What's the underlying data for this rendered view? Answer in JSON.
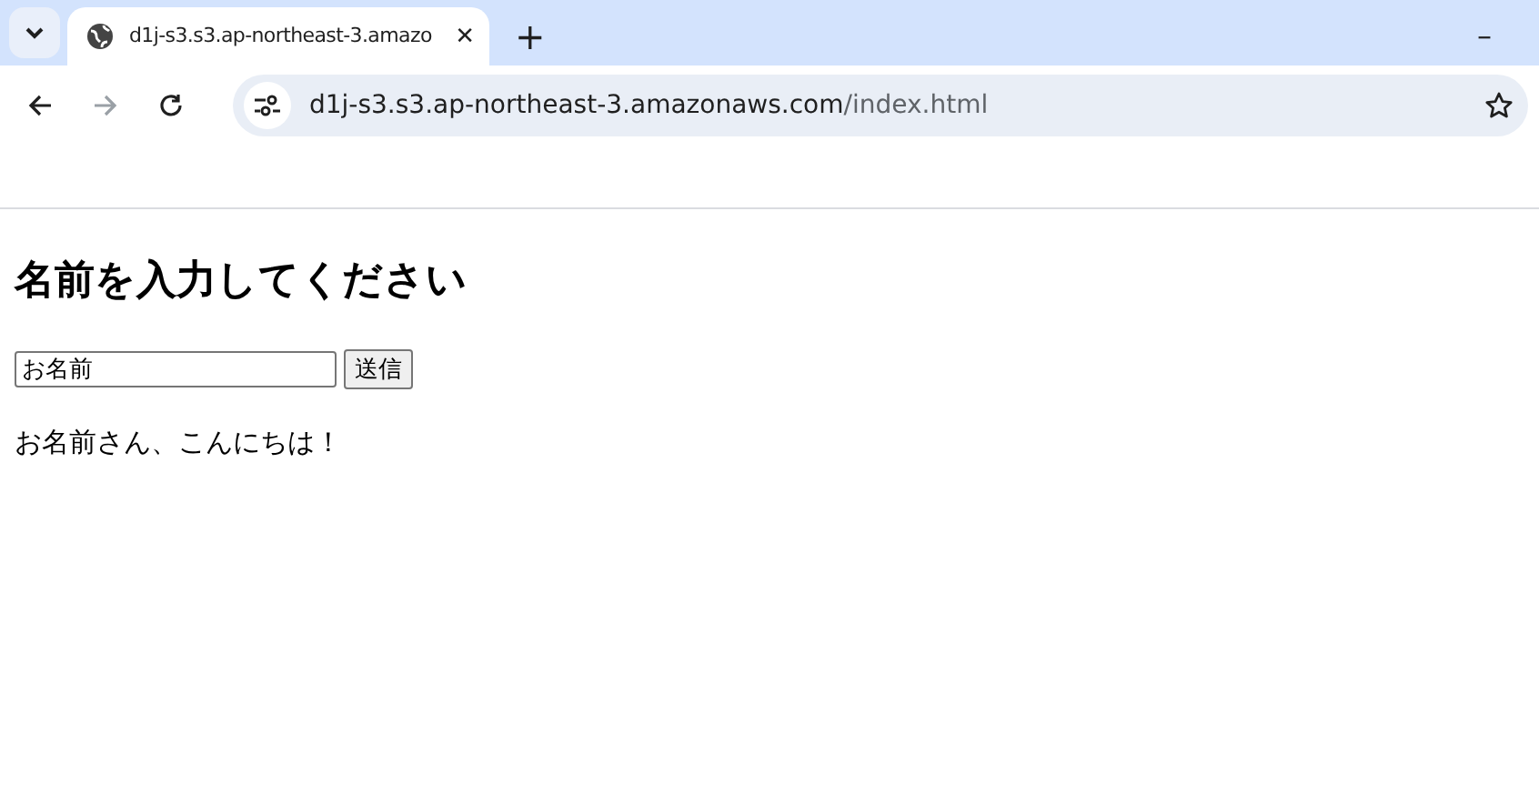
{
  "browser": {
    "tab": {
      "title": "d1j-s3.s3.ap-northeast-3.amazo",
      "close": "✕"
    },
    "new_tab": "+",
    "minimize": "–",
    "url": {
      "host": "d1j-s3.s3.ap-northeast-3.amazonaws.com",
      "path": "/index.html"
    }
  },
  "page": {
    "heading": "名前を入力してください",
    "name_field": {
      "value": "お名前"
    },
    "submit": "送信",
    "greeting": "お名前さん、こんにちは！"
  }
}
